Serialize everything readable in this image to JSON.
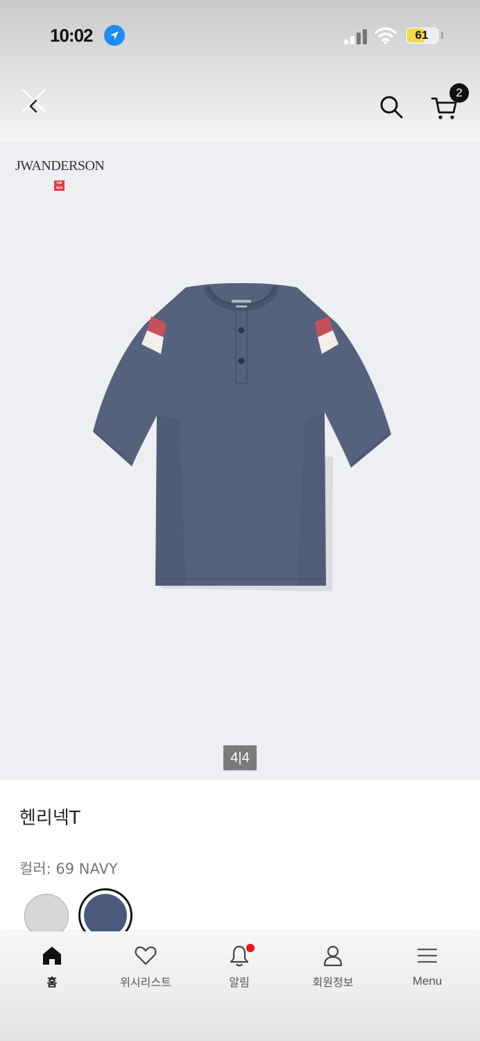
{
  "status_bar": {
    "time": "10:02",
    "battery": "61",
    "battery_level": 0.61
  },
  "nav": {
    "cart_count": "2"
  },
  "product": {
    "brand": "JWANDERSON",
    "co_brand": "UNI QLO",
    "image_counter": "4|4",
    "title": "헨리넥T",
    "color_label": "컬러: 69 NAVY",
    "swatches": [
      {
        "name": "gray",
        "color": "#d6d7d8",
        "selected": false
      },
      {
        "name": "navy",
        "color": "#4b5a7b",
        "selected": true
      }
    ],
    "shirt_color": "#56627d"
  },
  "tab_bar": {
    "items": [
      {
        "label": "홈",
        "icon": "home-icon",
        "active": true
      },
      {
        "label": "위시리스트",
        "icon": "heart-icon",
        "active": false
      },
      {
        "label": "알림",
        "icon": "bell-icon",
        "active": false
      },
      {
        "label": "회원정보",
        "icon": "user-icon",
        "active": false
      },
      {
        "label": "Menu",
        "icon": "menu-icon",
        "active": false
      }
    ]
  }
}
